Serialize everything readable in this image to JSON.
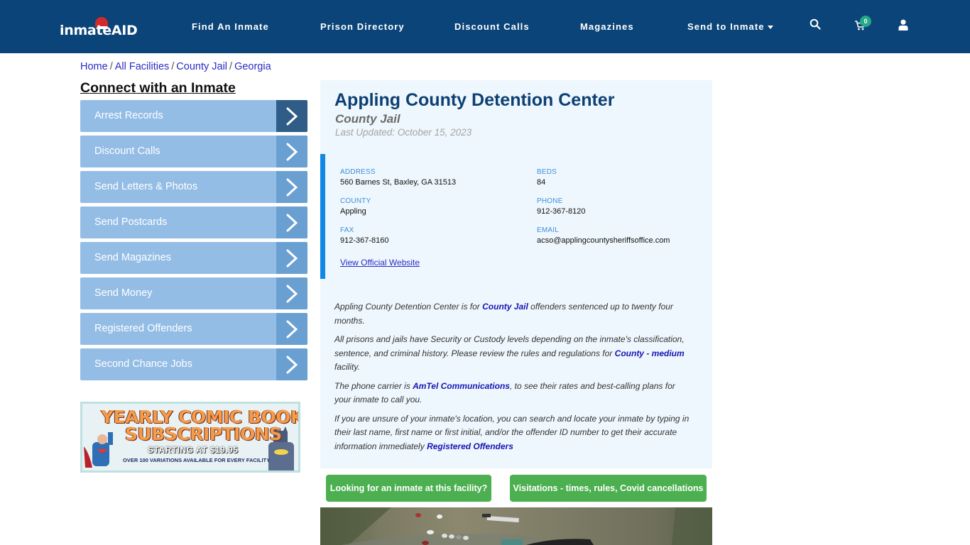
{
  "header": {
    "logo": {
      "text_main": "inmate",
      "text_accent": "AID"
    },
    "nav": [
      {
        "label": "Find An Inmate"
      },
      {
        "label": "Prison Directory"
      },
      {
        "label": "Discount Calls"
      },
      {
        "label": "Magazines"
      },
      {
        "label": "Send to Inmate",
        "has_dropdown": true
      }
    ],
    "icons": {
      "search": "search-icon",
      "cart": "cart-icon",
      "user": "user-icon"
    },
    "cart_count": "0"
  },
  "breadcrumb": [
    {
      "label": "Home"
    },
    {
      "label": "All Facilities"
    },
    {
      "label": "County Jail"
    },
    {
      "label": "Georgia"
    }
  ],
  "sidebar": {
    "title": "Connect with an Inmate",
    "items": [
      {
        "label": "Arrest Records",
        "active": true
      },
      {
        "label": "Discount Calls"
      },
      {
        "label": "Send Letters & Photos"
      },
      {
        "label": "Send Postcards"
      },
      {
        "label": "Send Magazines"
      },
      {
        "label": "Send Money"
      },
      {
        "label": "Registered Offenders"
      },
      {
        "label": "Second Chance Jobs"
      }
    ],
    "ad": {
      "line1": "YEARLY COMIC BOOK",
      "line2": "SUBSCRIPTIONS",
      "line3": "STARTING AT $19.95",
      "line4": "OVER 100 VARIATIONS AVAILABLE FOR EVERY FACILITY"
    }
  },
  "facility": {
    "name": "Appling County Detention Center",
    "type": "County Jail",
    "last_updated": "Last Updated: October 15, 2023",
    "fields": {
      "address": {
        "label": "ADDRESS",
        "value": "560 Barnes St, Baxley, GA 31513"
      },
      "beds": {
        "label": "BEDS",
        "value": "84"
      },
      "county": {
        "label": "COUNTY",
        "value": "Appling"
      },
      "phone": {
        "label": "PHONE",
        "value": "912-367-8120"
      },
      "fax": {
        "label": "FAX",
        "value": "912-367-8160"
      },
      "email": {
        "label": "EMAIL",
        "value": "acso@applingcountysheriffsoffice.com"
      }
    },
    "website_link": "View Official Website",
    "description": {
      "p1": {
        "pre": "Appling County Detention Center is for ",
        "link": "County Jail",
        "post": " offenders sentenced up to twenty four months."
      },
      "p2": {
        "pre": "All prisons and jails have Security or Custody levels depending on the inmate's classification, sentence, and criminal history. Please review the rules and regulations for ",
        "link": "County - medium",
        "post": " facility."
      },
      "p3": {
        "pre": "The phone carrier is ",
        "link": "AmTel Communications",
        "post": ", to see their rates and best-calling plans for your inmate to call you."
      },
      "p4": {
        "pre": "If you are unsure of your inmate's location, you can search and locate your inmate by typing in their last name, first name or first initial, and/or the offender ID number to get their accurate information immediately ",
        "link": "Registered Offenders",
        "post": ""
      }
    },
    "buttons": {
      "looking": "Looking for an inmate at this facility?",
      "visitations": "Visitations - times, rules, Covid cancellations"
    }
  },
  "colors": {
    "header_bg": "#0b4479",
    "menu_bg": "#94bde6",
    "menu_arrow": "#6a9fd2",
    "menu_arrow_active": "#2f5d88",
    "accent_border": "#1188e6",
    "button_green": "#4caf50",
    "title": "#0d3f73"
  }
}
